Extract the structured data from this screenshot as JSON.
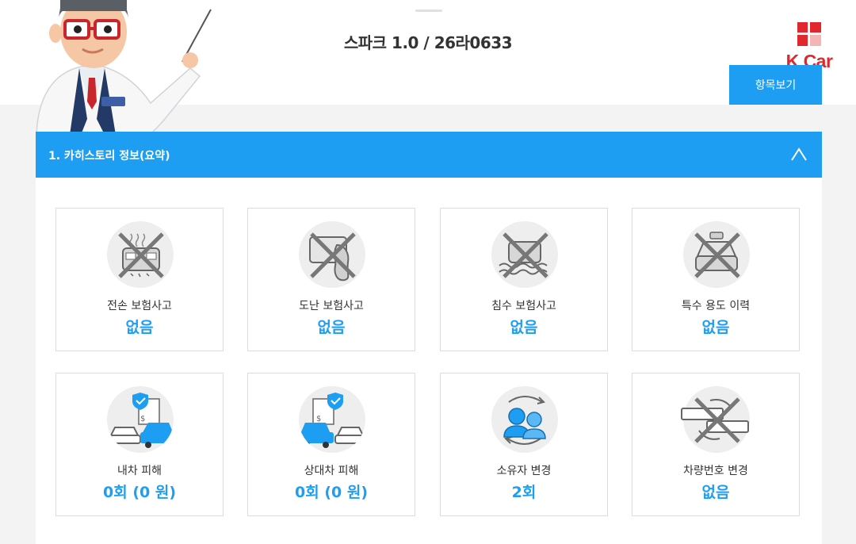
{
  "header": {
    "car_title": "스파크 1.0 / 26라0633",
    "items_button": "항목보기",
    "brand": "K Car"
  },
  "section": {
    "title": "1. 카히스토리 정보(요약)"
  },
  "cards": [
    {
      "label": "전손 보험사고",
      "value": "없음",
      "icon": "total-loss-car-icon"
    },
    {
      "label": "도난 보험사고",
      "value": "없음",
      "icon": "theft-icon"
    },
    {
      "label": "침수 보험사고",
      "value": "없음",
      "icon": "flood-car-icon"
    },
    {
      "label": "특수 용도 이력",
      "value": "없음",
      "icon": "special-use-car-icon"
    },
    {
      "label": "내차 피해",
      "value": "0회 (0 원)",
      "icon": "own-car-damage-icon"
    },
    {
      "label": "상대차 피해",
      "value": "0회 (0 원)",
      "icon": "other-car-damage-icon"
    },
    {
      "label": "소유자 변경",
      "value": "2회",
      "icon": "owner-change-icon"
    },
    {
      "label": "차량번호 변경",
      "value": "없음",
      "icon": "plate-change-icon"
    }
  ],
  "colors": {
    "accent": "#1e9ef2",
    "brand": "#e1262d"
  }
}
